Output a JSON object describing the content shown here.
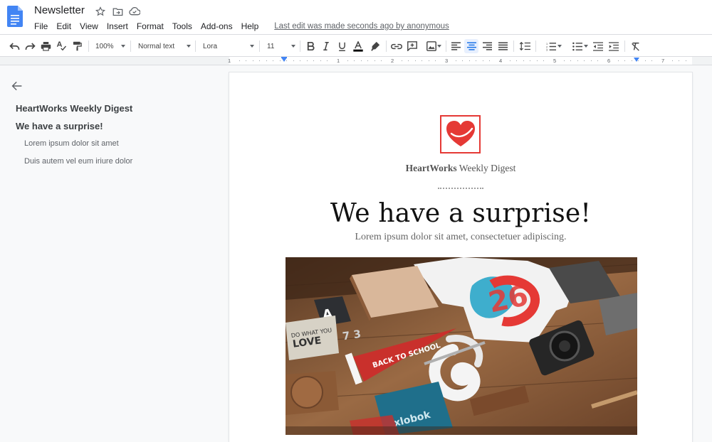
{
  "app": {
    "doc_title": "Newsletter",
    "menu": [
      "File",
      "Edit",
      "View",
      "Insert",
      "Format",
      "Tools",
      "Add-ons",
      "Help"
    ],
    "last_edit": "Last edit was made seconds ago by anonymous"
  },
  "toolbar": {
    "zoom": "100%",
    "style": "Normal text",
    "font": "Lora",
    "font_size": "11",
    "active_alignment": "center"
  },
  "ruler": {
    "numbers": [
      "1",
      "1",
      "2",
      "3",
      "4",
      "5",
      "6",
      "7"
    ]
  },
  "outline": {
    "items": [
      {
        "label": "HeartWorks Weekly Digest",
        "level": 1
      },
      {
        "label": "We have a surprise!",
        "level": 1
      },
      {
        "label": "Lorem ipsum dolor sit amet",
        "level": 2
      },
      {
        "label": "Duis autem vel eum iriure dolor",
        "level": 2
      }
    ]
  },
  "document": {
    "brand_bold": "HeartWorks",
    "brand_rest": " Weekly Digest",
    "headline": "We have a surprise!",
    "subhead": "Lorem ipsum dolor sit amet, consectetuer adipiscing.",
    "hero_image": "flat-lay-desk-photo",
    "hero_texts": [
      "BACK TO SCHOOL",
      "LOVE",
      "26"
    ]
  },
  "colors": {
    "accent": "#1a73e8",
    "logo_red": "#e53935",
    "docs_blue": "#4285f4"
  }
}
